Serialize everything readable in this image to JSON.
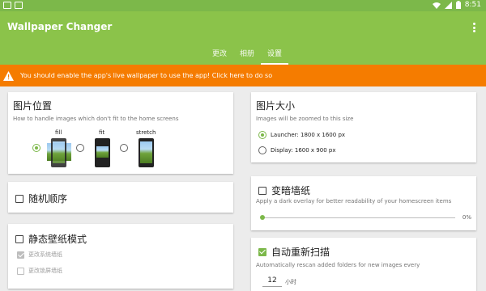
{
  "status_bar": {
    "time": "8:51",
    "left_icons": [
      "gallery-icon",
      "notification-icon"
    ],
    "right_icons": [
      "wifi-icon",
      "signal-icon",
      "battery-icon"
    ]
  },
  "app_bar": {
    "title": "Wallpaper Changer",
    "menu_icon": "more-vert-icon",
    "tabs": [
      {
        "label": "更改",
        "active": false
      },
      {
        "label": "相册",
        "active": false
      },
      {
        "label": "设置",
        "active": true
      }
    ]
  },
  "warning": {
    "icon": "warning-icon",
    "text": "You should enable the app's live wallpaper to use the app! Click here to do so",
    "color": "#f57c00"
  },
  "settings": {
    "image_position": {
      "title": "图片位置",
      "description": "How to handle images which don't fit to the home screens",
      "options": [
        {
          "label": "fill",
          "selected": true
        },
        {
          "label": "fit",
          "selected": false
        },
        {
          "label": "stretch",
          "selected": false
        }
      ]
    },
    "image_size": {
      "title": "图片大小",
      "description": "Images will be zoomed to this size",
      "options": [
        {
          "label": "Launcher: 1800 x 1600 px",
          "selected": true
        },
        {
          "label": "Display: 1600 x 900 px",
          "selected": false
        }
      ]
    },
    "random_order": {
      "label": "随机顺序",
      "checked": false
    },
    "darken_wallpaper": {
      "label": "变暗墙纸",
      "checked": false,
      "description": "Apply a dark overlay for better readability of your homescreen items",
      "slider_value": 0,
      "slider_display": "0%"
    },
    "static_wallpaper": {
      "label": "静态壁纸模式",
      "checked": false,
      "sub_options": [
        {
          "label": "更改系统墙纸",
          "checked": true,
          "enabled": false
        },
        {
          "label": "更改锁屏墙纸",
          "checked": false,
          "enabled": false
        }
      ]
    },
    "auto_rescan": {
      "label": "自动重新扫描",
      "checked": true,
      "description": "Automatically rescan added folders for new images every",
      "interval_value": "12",
      "interval_unit": "小时"
    }
  },
  "colors": {
    "status_bar": "#7cb84a",
    "app_bar": "#8bc34a",
    "accent": "#7cb84a",
    "background": "#ececec"
  }
}
